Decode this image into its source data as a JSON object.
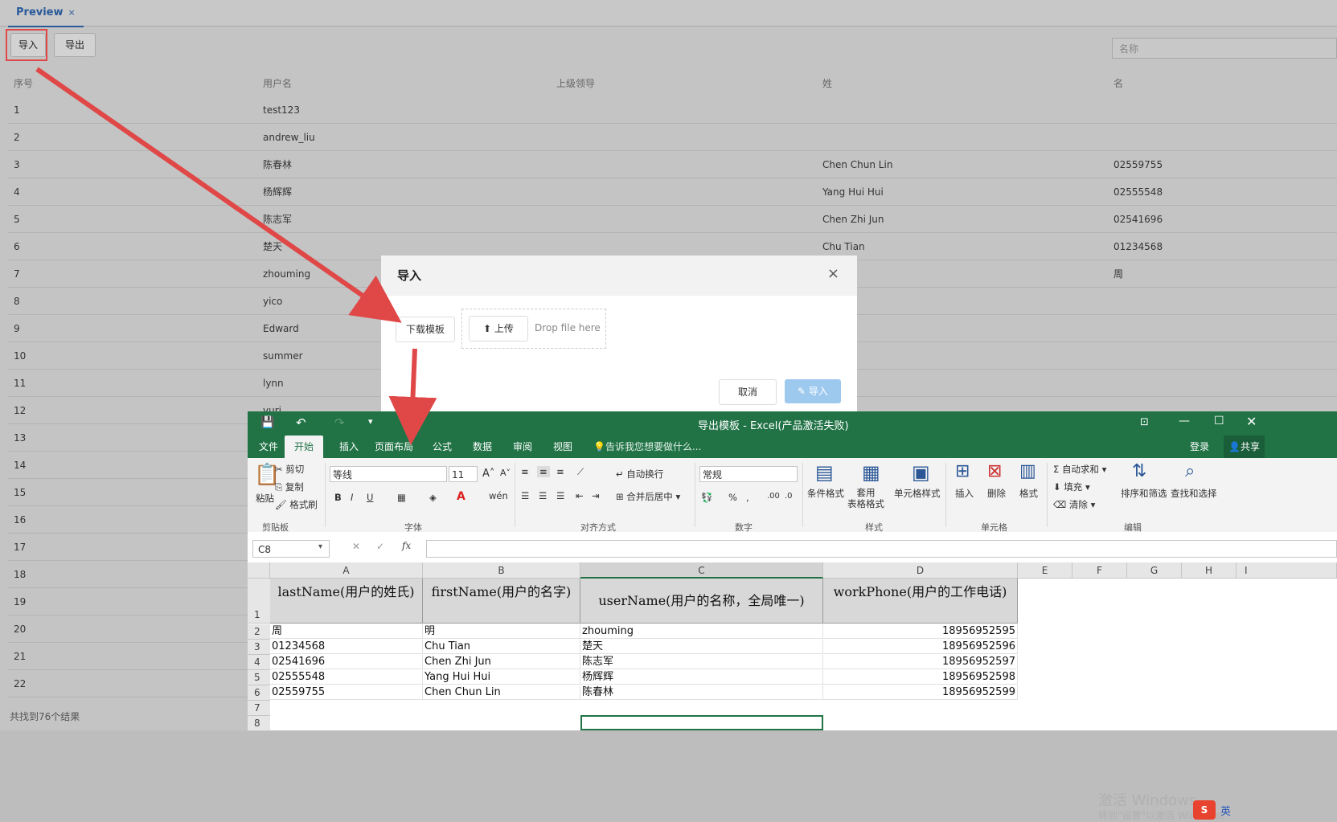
{
  "app": {
    "tab_label": "Preview",
    "tab_close": "×",
    "import_button": "导入",
    "export_button": "导出",
    "search_placeholder": "名称",
    "columns": [
      "序号",
      "用户名",
      "上级领导",
      "姓",
      "名"
    ],
    "rows": [
      [
        "1",
        "test123",
        "",
        "",
        ""
      ],
      [
        "2",
        "andrew_liu",
        "",
        "",
        ""
      ],
      [
        "3",
        "陈春林",
        "",
        "Chen Chun Lin",
        "02559755"
      ],
      [
        "4",
        "杨辉辉",
        "",
        "Yang Hui Hui",
        "02555548"
      ],
      [
        "5",
        "陈志军",
        "",
        "Chen Zhi Jun",
        "02541696"
      ],
      [
        "6",
        "楚天",
        "",
        "Chu Tian",
        "01234568"
      ],
      [
        "7",
        "zhouming",
        "",
        "",
        "周"
      ],
      [
        "8",
        "yico",
        "",
        "",
        ""
      ],
      [
        "9",
        "Edward",
        "",
        "",
        ""
      ],
      [
        "10",
        "summer",
        "",
        "",
        ""
      ],
      [
        "11",
        "lynn",
        "",
        "",
        ""
      ],
      [
        "12",
        "yuri",
        "",
        "",
        ""
      ],
      [
        "13",
        "",
        "",
        "",
        ""
      ],
      [
        "14",
        "",
        "",
        "",
        ""
      ],
      [
        "15",
        "",
        "",
        "",
        ""
      ],
      [
        "16",
        "",
        "",
        "",
        ""
      ],
      [
        "17",
        "",
        "",
        "",
        ""
      ],
      [
        "18",
        "",
        "",
        "",
        ""
      ],
      [
        "19",
        "",
        "",
        "",
        ""
      ],
      [
        "20",
        "",
        "",
        "",
        ""
      ],
      [
        "21",
        "",
        "",
        "",
        ""
      ],
      [
        "22",
        "",
        "",
        "",
        ""
      ]
    ],
    "footer": "共找到76个结果"
  },
  "dialog": {
    "title": "导入",
    "close": "×",
    "download_template": "下载模板",
    "upload_label": "上传",
    "drop_hint": "Drop file here",
    "cancel": "取消",
    "confirm": "导入"
  },
  "excel": {
    "title": "导出模板 - Excel(产品激活失败)",
    "login": "登录",
    "share": "共享",
    "menu": [
      "文件",
      "开始",
      "插入",
      "页面布局",
      "公式",
      "数据",
      "审阅",
      "视图"
    ],
    "tell_me": "告诉我您想要做什么...",
    "ribbon": {
      "paste": "粘贴",
      "cut": "剪切",
      "copy": "复制",
      "format_painter": "格式刷",
      "clipboard": "剪贴板",
      "font_name": "等线",
      "font_size": "11",
      "font_group": "字体",
      "wrap_text": "自动换行",
      "merge_center": "合并后居中",
      "alignment_group": "对齐方式",
      "number_format": "常规",
      "number_group": "数字",
      "conditional_format": "条件格式",
      "table_format": "套用\n表格格式",
      "cell_style": "单元格样式",
      "styles_group": "样式",
      "insert": "插入",
      "delete": "删除",
      "format": "格式",
      "cells_group": "单元格",
      "autosum": "自动求和",
      "fill": "填充",
      "clear": "清除",
      "sort_filter": "排序和筛选",
      "find_select": "查找和选择",
      "editing_group": "编辑"
    },
    "name_box": "C8",
    "fx": "fx",
    "col_headers": [
      "A",
      "B",
      "C",
      "D",
      "E",
      "F",
      "G",
      "H",
      "I"
    ],
    "header_row": [
      "lastName(用户的姓氏)",
      "firstName(用户的名字)",
      "userName(用户的名称，全局唯一)",
      "workPhone(用户的工作电话)"
    ],
    "data_rows": [
      [
        "周",
        "明",
        "zhouming",
        "18956952595"
      ],
      [
        "01234568",
        "Chu Tian",
        "楚天",
        "18956952596"
      ],
      [
        "02541696",
        "Chen Zhi Jun",
        "陈志军",
        "18956952597"
      ],
      [
        "02555548",
        "Yang Hui Hui",
        "杨辉辉",
        "18956952598"
      ],
      [
        "02559755",
        "Chen Chun Lin",
        "陈春林",
        "18956952599"
      ]
    ],
    "watermark_line1": "激活 Windows",
    "watermark_line2": "转到\"设置\"以激活 Windows。",
    "ime_label": "英"
  },
  "colors": {
    "excel_green": "#217346",
    "annotation_red": "#e04848",
    "primary_disabled": "#9ec9ef"
  }
}
